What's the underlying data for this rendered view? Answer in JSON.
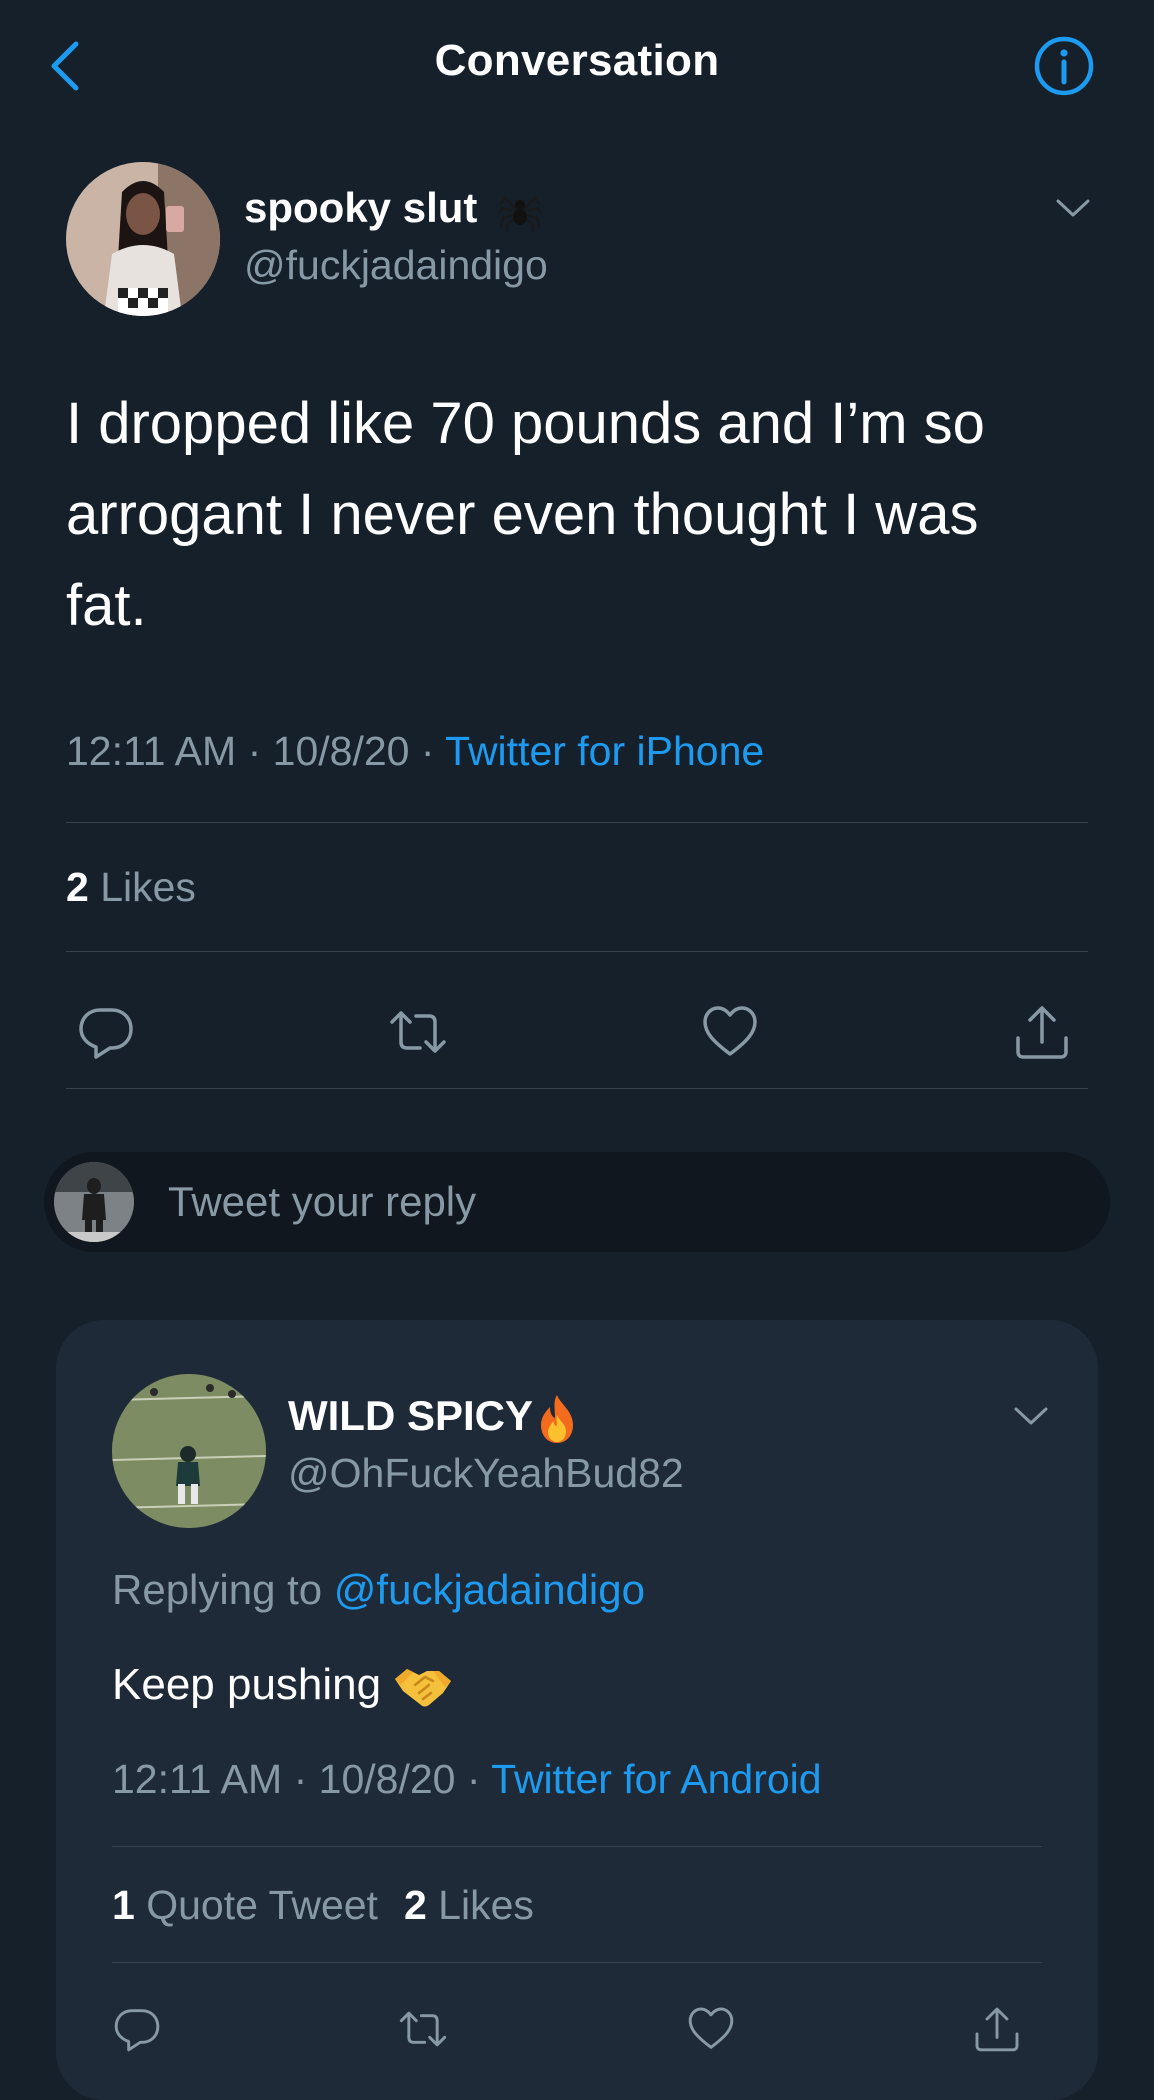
{
  "header": {
    "title": "Conversation",
    "back_icon": "chevron-left-icon",
    "info_icon": "info-icon"
  },
  "main_tweet": {
    "display_name": "spooky slut",
    "name_emoji": "spider-icon",
    "handle": "@fuckjadaindigo",
    "text": "I dropped like 70 pounds and I’m so arrogant I never even thought I was fat.",
    "time": "12:11 AM",
    "date": "10/8/20",
    "source": "Twitter for iPhone",
    "likes_count": "2",
    "likes_label": "Likes"
  },
  "composer": {
    "placeholder": "Tweet your reply"
  },
  "reply_tweet": {
    "display_name": "WILD SPICY",
    "name_emoji": "fire-icon",
    "handle": "@OhFuckYeahBud82",
    "replying_to_label": "Replying to",
    "replying_to_handle": "@fuckjadaindigo",
    "text": "Keep pushing",
    "text_emoji": "handshake-icon",
    "time": "12:11 AM",
    "date": "10/8/20",
    "source": "Twitter for Android",
    "quote_count": "1",
    "quote_label": "Quote Tweet",
    "likes_count": "2",
    "likes_label": "Likes"
  },
  "colors": {
    "background": "#15202b",
    "card": "#1f2a38",
    "accent": "#1d9bf0",
    "secondary_text": "#8899a6",
    "divider": "#38444d"
  }
}
